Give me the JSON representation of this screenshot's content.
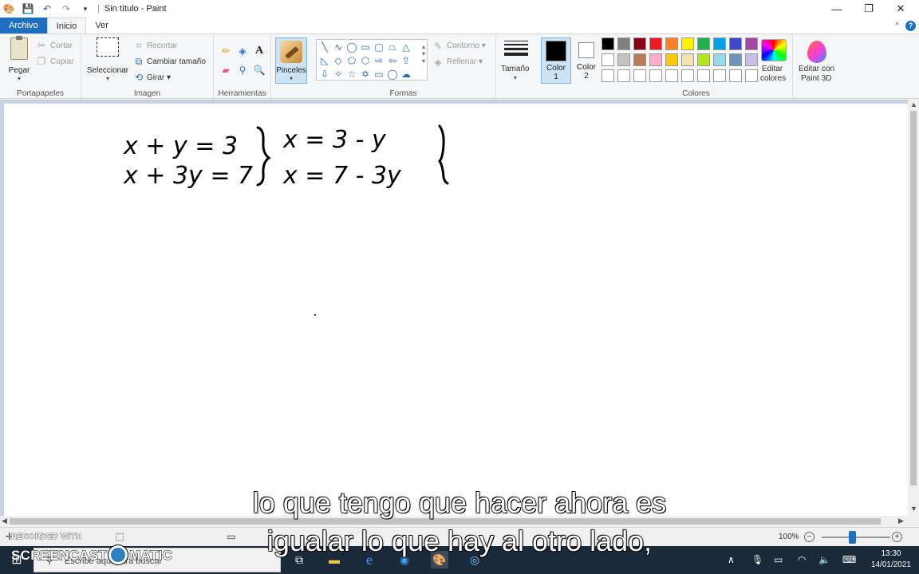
{
  "window": {
    "title": "Sin título - Paint",
    "minimize": "—",
    "maximize": "❐",
    "close": "✕"
  },
  "tabs": [
    {
      "label": "Archivo"
    },
    {
      "label": "Inicio"
    },
    {
      "label": "Ver"
    }
  ],
  "tab_right": {
    "collapse": "^",
    "help": "?"
  },
  "ribbon": {
    "portapapeles": {
      "label": "Portapapeles",
      "pegar": "Pegar",
      "cortar": "Cortar",
      "copiar": "Copiar"
    },
    "imagen": {
      "label": "Imagen",
      "seleccionar": "Seleccionar",
      "recortar": "Recortar",
      "cambiar_tamano": "Cambiar tamaño",
      "girar": "Girar"
    },
    "herramientas": {
      "label": "Herramientas"
    },
    "pinceles": {
      "label": "Pinceles"
    },
    "formas": {
      "label": "Formas",
      "contorno": "Contorno",
      "rellenar": "Rellenar"
    },
    "tamano": {
      "label": "Tamaño"
    },
    "color1": {
      "label": "Color",
      "num": "1",
      "color": "#000000"
    },
    "color2": {
      "label": "Color",
      "num": "2",
      "color": "#ffffff"
    },
    "colores": {
      "label": "Colores",
      "editar": "Editar",
      "editar2": "colores"
    },
    "paint3d": {
      "line1": "Editar con",
      "line2": "Paint 3D"
    }
  },
  "palette": {
    "row1": [
      "#000000",
      "#7f7f7f",
      "#880015",
      "#ed1c24",
      "#ff7f27",
      "#fff200",
      "#22b14c",
      "#00a2e8",
      "#3f48cc",
      "#a349a4"
    ],
    "row2": [
      "#ffffff",
      "#c3c3c3",
      "#b97a57",
      "#ffaec9",
      "#ffc90e",
      "#efe4b0",
      "#b5e61d",
      "#99d9ea",
      "#7092be",
      "#c8bfe7"
    ],
    "row3": [
      "#ffffff",
      "#ffffff",
      "#ffffff",
      "#ffffff",
      "#ffffff",
      "#ffffff",
      "#ffffff",
      "#ffffff",
      "#ffffff",
      "#ffffff"
    ]
  },
  "canvas": {
    "eq1_left": "x + y = 3",
    "eq2_left": "x + 3y = 7",
    "eq1_right": "x = 3 - y",
    "eq2_right": "x = 7 - 3y"
  },
  "status": {
    "zoom": "100%"
  },
  "taskbar": {
    "search_placeholder": "Escribe aquí para buscar",
    "time": "13:30",
    "date": "14/01/2021"
  },
  "subtitle": {
    "line1": "lo que tengo que hacer ahora es",
    "line2": "igualar lo que hay al otro lado,"
  },
  "watermark": {
    "small": "RECORDED WITH",
    "big_left": "SCREENCAST",
    "big_right": "MATIC"
  }
}
